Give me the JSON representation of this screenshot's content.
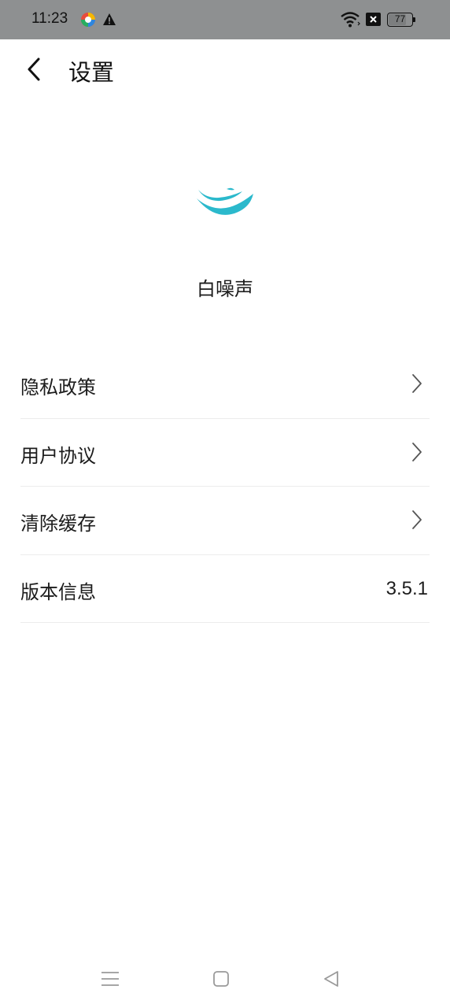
{
  "status_bar": {
    "time": "11:23",
    "battery": "77",
    "battery_level": 0.77,
    "icons": [
      "app-notification-icon",
      "warning-icon",
      "wifi-icon",
      "sim-card-icon",
      "battery-icon"
    ]
  },
  "header": {
    "title": "设置",
    "back_icon": "chevron-left-icon"
  },
  "app": {
    "name": "白噪声",
    "logo_icon": "whale-logo-icon",
    "accent_color": "#2bb9cc"
  },
  "settings": [
    {
      "label": "隐私政策",
      "action_icon": "chevron-right-icon"
    },
    {
      "label": "用户协议",
      "action_icon": "chevron-right-icon"
    },
    {
      "label": "清除缓存",
      "action_icon": "chevron-right-icon"
    },
    {
      "label": "版本信息",
      "value": "3.5.1"
    }
  ],
  "nav_bar": {
    "icons": [
      "menu-icon",
      "home-icon",
      "back-triangle-icon"
    ]
  }
}
